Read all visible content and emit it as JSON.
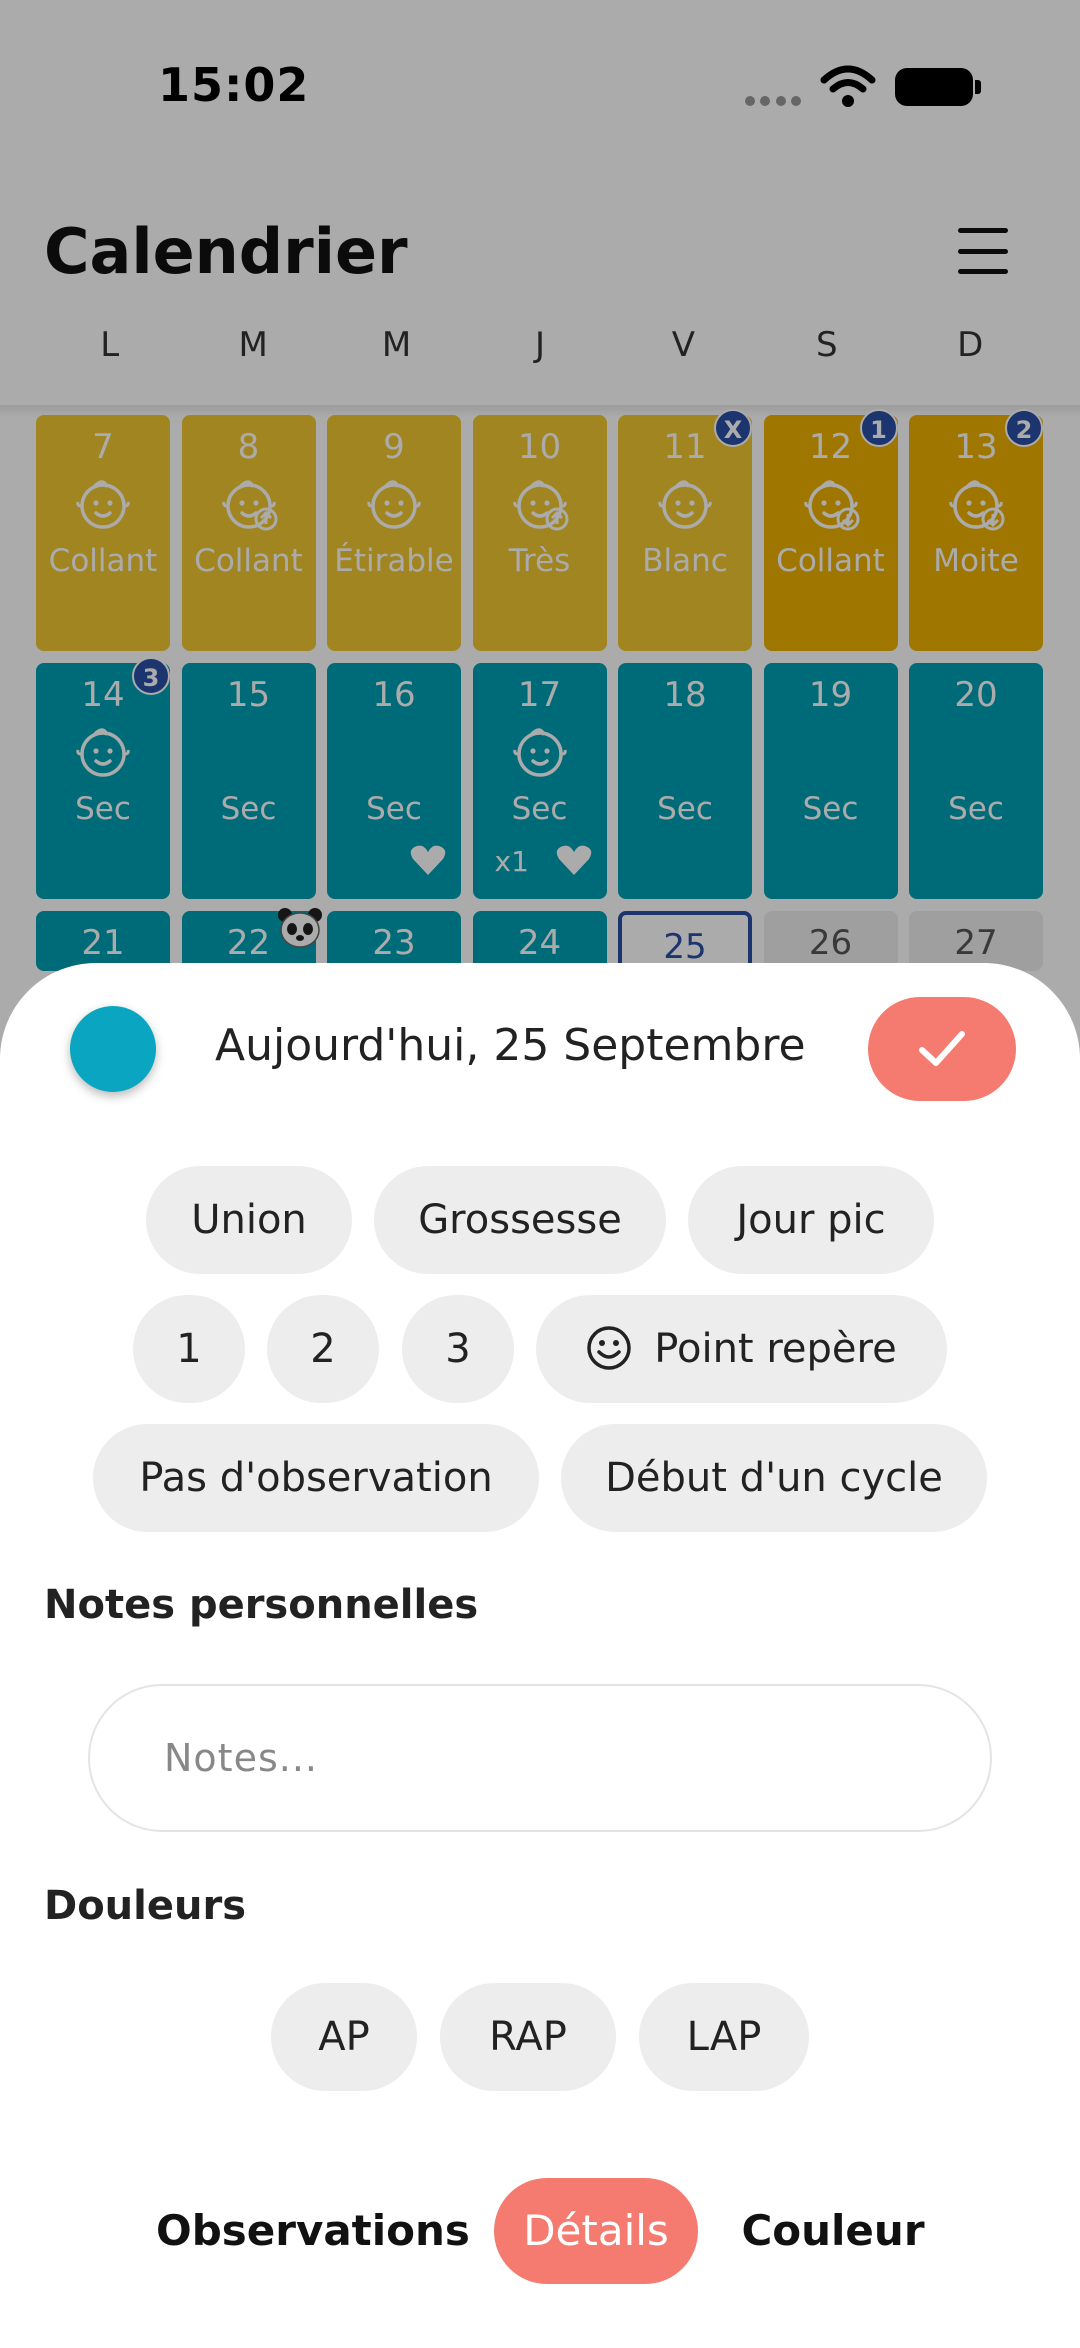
{
  "status_bar": {
    "time": "15:02"
  },
  "header": {
    "title": "Calendrier"
  },
  "weekdays": [
    "L",
    "M",
    "M",
    "J",
    "V",
    "S",
    "D"
  ],
  "calendar": {
    "colors": {
      "fertile_light": "#f0c630",
      "fertile_dark": "#eeb000",
      "dry": "#00a0b3",
      "today_border": "#2a4fa6",
      "future": "#ededed"
    },
    "rows": [
      {
        "days": [
          {
            "num": "7",
            "label": "Collant",
            "icon": "baby-icon"
          },
          {
            "num": "8",
            "label": "Collant",
            "icon": "baby-up-icon"
          },
          {
            "num": "9",
            "label": "Étirable",
            "icon": "baby-icon"
          },
          {
            "num": "10",
            "label": "Très",
            "icon": "baby-up-icon"
          },
          {
            "num": "11",
            "label": "Blanc",
            "icon": "baby-icon",
            "badge": "X"
          },
          {
            "num": "12",
            "label": "Collant",
            "icon": "baby-down-icon",
            "badge": "1"
          },
          {
            "num": "13",
            "label": "Moite",
            "icon": "baby-down-icon",
            "badge": "2"
          }
        ]
      },
      {
        "days": [
          {
            "num": "14",
            "label": "Sec",
            "icon": "baby-icon",
            "badge": "3"
          },
          {
            "num": "15",
            "label": "Sec"
          },
          {
            "num": "16",
            "label": "Sec",
            "heart": true
          },
          {
            "num": "17",
            "label": "Sec",
            "icon": "baby-icon",
            "heart": true,
            "count": "x1"
          },
          {
            "num": "18",
            "label": "Sec"
          },
          {
            "num": "19",
            "label": "Sec"
          },
          {
            "num": "20",
            "label": "Sec"
          }
        ]
      },
      {
        "days": [
          {
            "num": "21"
          },
          {
            "num": "22",
            "panda": true
          },
          {
            "num": "23"
          },
          {
            "num": "24"
          },
          {
            "num": "25",
            "today": true
          },
          {
            "num": "26"
          },
          {
            "num": "27"
          }
        ]
      }
    ]
  },
  "sheet": {
    "date_title": "Aujourd'hui, 25 Septembre",
    "dot_color": "#0aa6c1",
    "accent": "#f57a6f",
    "chips_row1": [
      "Union",
      "Grossesse",
      "Jour pic"
    ],
    "chips_row2": [
      "1",
      "2",
      "3",
      "Point repère"
    ],
    "chips_row3": [
      "Pas d'observation",
      "Début d'un cycle"
    ],
    "notes_label": "Notes personnelles",
    "notes_placeholder": "Notes...",
    "pain_label": "Douleurs",
    "pain_chips": [
      "AP",
      "RAP",
      "LAP"
    ],
    "tabs": [
      "Observations",
      "Détails",
      "Couleur"
    ],
    "active_tab": "Détails"
  }
}
